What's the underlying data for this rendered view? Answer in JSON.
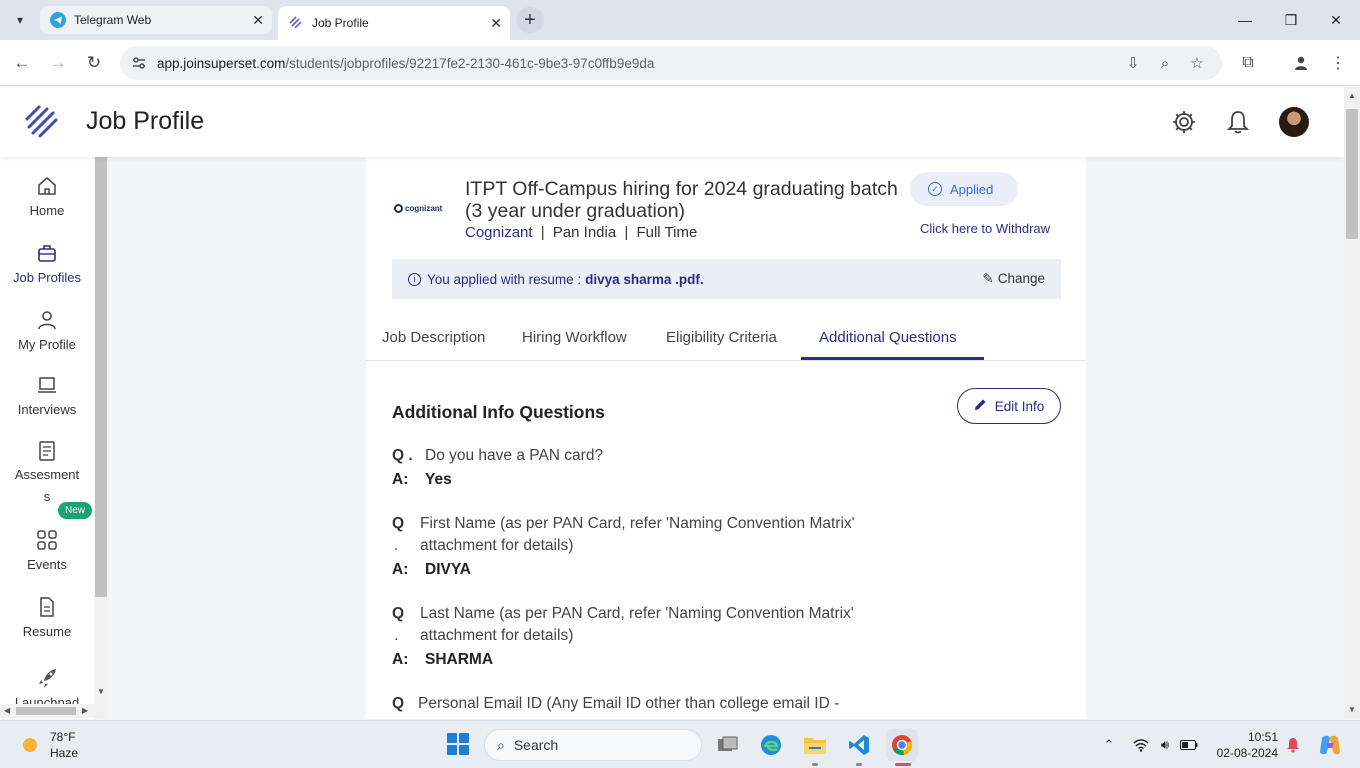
{
  "browser": {
    "tabs": [
      {
        "title": "Telegram Web",
        "active": false
      },
      {
        "title": "Job Profile",
        "active": true
      }
    ],
    "url_host": "app.joinsuperset.com",
    "url_path": "/students/jobprofiles/92217fe2-2130-461c-9be3-97c0ffb9e9da"
  },
  "header": {
    "title": "Job Profile"
  },
  "sidebar": {
    "items": [
      {
        "label": "Home",
        "icon": "home-icon"
      },
      {
        "label": "Job Profiles",
        "icon": "briefcase-icon",
        "active": true
      },
      {
        "label": "My Profile",
        "icon": "person-icon"
      },
      {
        "label": "Interviews",
        "icon": "laptop-icon"
      },
      {
        "label": "Assesment",
        "label_line2": "s",
        "icon": "document-icon"
      },
      {
        "label": "Events",
        "icon": "grid-icon"
      },
      {
        "label": "Resume",
        "icon": "resume-icon"
      },
      {
        "label": "Launchpad",
        "icon": "rocket-icon"
      }
    ],
    "new_badge": "New"
  },
  "job": {
    "title_line1": "ITPT Off-Campus hiring for 2024 graduating batch",
    "title_line2": "(3 year under graduation)",
    "company": "Cognizant",
    "location": "Pan India",
    "job_type": "Full Time",
    "status": "Applied",
    "withdraw_label": "Click here to Withdraw",
    "company_logo_text": "cognizant"
  },
  "resume_notice": {
    "prefix": "You applied with resume :",
    "filename": "divya sharma .pdf.",
    "change_label": "Change"
  },
  "content_tabs": [
    {
      "label": "Job Description"
    },
    {
      "label": "Hiring Workflow"
    },
    {
      "label": "Eligibility Criteria"
    },
    {
      "label": "Additional Questions",
      "active": true
    }
  ],
  "additional": {
    "title": "Additional Info Questions",
    "edit_label": "Edit Info",
    "questions": [
      {
        "q_label": "Q .",
        "q": "Do you have a PAN card?",
        "a_label": "A:",
        "a": "Yes"
      },
      {
        "q_label": "Q",
        "q": "First Name (as per PAN Card, refer 'Naming Convention Matrix' attachment for details)",
        "q_cont": ".",
        "a_label": "A:",
        "a": "DIVYA"
      },
      {
        "q_label": "Q",
        "q": "Last Name (as per PAN Card, refer 'Naming Convention Matrix' attachment for details)",
        "q_cont": ".",
        "a_label": "A:",
        "a": "SHARMA"
      },
      {
        "q_label": "Q",
        "q": "Personal Email ID (Any Email ID other than college email ID -",
        "a_label": "",
        "a": ""
      }
    ]
  },
  "taskbar": {
    "temperature": "78°F",
    "condition": "Haze",
    "search_placeholder": "Search",
    "time": "10:51",
    "date": "02-08-2024"
  },
  "colors": {
    "primary": "#2c2b89",
    "applied_text": "#3b6fc7",
    "new_badge": "#1aa374"
  }
}
